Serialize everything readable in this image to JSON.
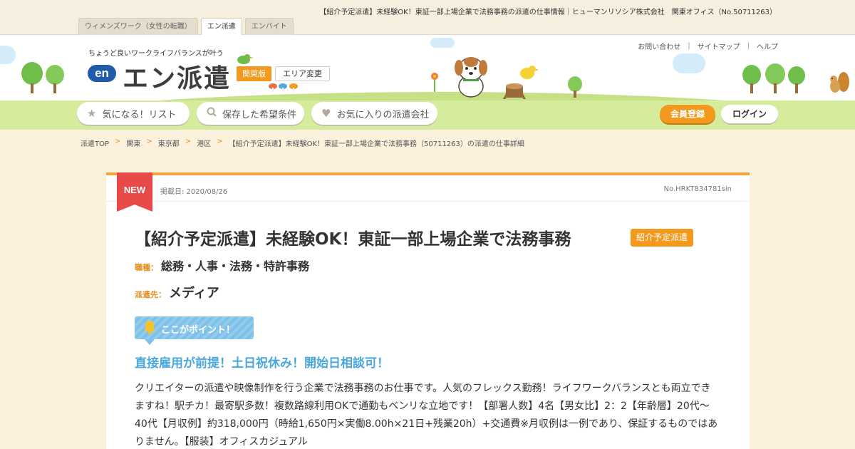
{
  "topbar": {
    "page_heading": "【紹介予定派遣】未経験OK！東証一部上場企業で法務事務の派遣の仕事情報｜ヒューマンリソシア株式会社　関東オフィス（No.50711263）",
    "tabs": [
      {
        "label": "ウィメンズワーク（女性の転職）",
        "active": false
      },
      {
        "label": "エン派遣",
        "active": true
      },
      {
        "label": "エンバイト",
        "active": false
      }
    ]
  },
  "header": {
    "tagline": "ちょうど良いワークライフバランスが叶う",
    "logo_mark": "en",
    "logo_text": "エン派遣",
    "region": "関東版",
    "area_change": "エリア変更",
    "util_links": [
      "お問い合わせ",
      "サイトマップ",
      "ヘルプ"
    ],
    "quick_buttons": [
      {
        "label": "気になる！リスト",
        "icon": "star-icon"
      },
      {
        "label": "保存した希望条件",
        "icon": "search-icon"
      },
      {
        "label": "お気に入りの派遣会社",
        "icon": "heart-icon"
      }
    ],
    "member_register": "会員登録",
    "login": "ログイン"
  },
  "breadcrumb": {
    "items": [
      "派遣TOP",
      "関東",
      "東京都",
      "港区",
      "【紹介予定派遣】未経験OK！東証一部上場企業で法務事務（50711263）の派遣の仕事詳細"
    ],
    "separator": ">"
  },
  "job": {
    "new_label": "NEW",
    "post_date": "掲載日: 2020/08/26",
    "job_no": "No.HRKT834781sin",
    "title": "【紹介予定派遣】未経験OK！東証一部上場企業で法務事務",
    "tag": "紹介予定派遣",
    "category_label": "職種：",
    "category": "総務・人事・法務・特許事務",
    "dispatch_label": "派遣先：",
    "dispatch": "メディア",
    "point_label": "ここがポイント！",
    "highlight": "直接雇用が前提！土日祝休み！開始日相談可！",
    "description": "クリエイターの派遣や映像制作を行う企業で法務事務のお仕事です。人気のフレックス勤務！ライフワークバランスとも両立できますね！駅チカ！最寄駅多数！複数路線利用OKで通勤もベンリな立地です！【部署人数】4名【男女比】2：2【年齢層】20代～40代【月収例】約318,000円（時給1,650円×実働8.00h×21日+残業20h）+交通費※月収例は一例であり、保証するものではありません。【服装】オフィスカジュアル"
  },
  "colors": {
    "accent_orange": "#f39a1e",
    "new_red": "#e84a4a",
    "point_blue": "#7dc0e8",
    "highlight_blue": "#4aa7dc",
    "page_bg": "#fcf1dd"
  }
}
